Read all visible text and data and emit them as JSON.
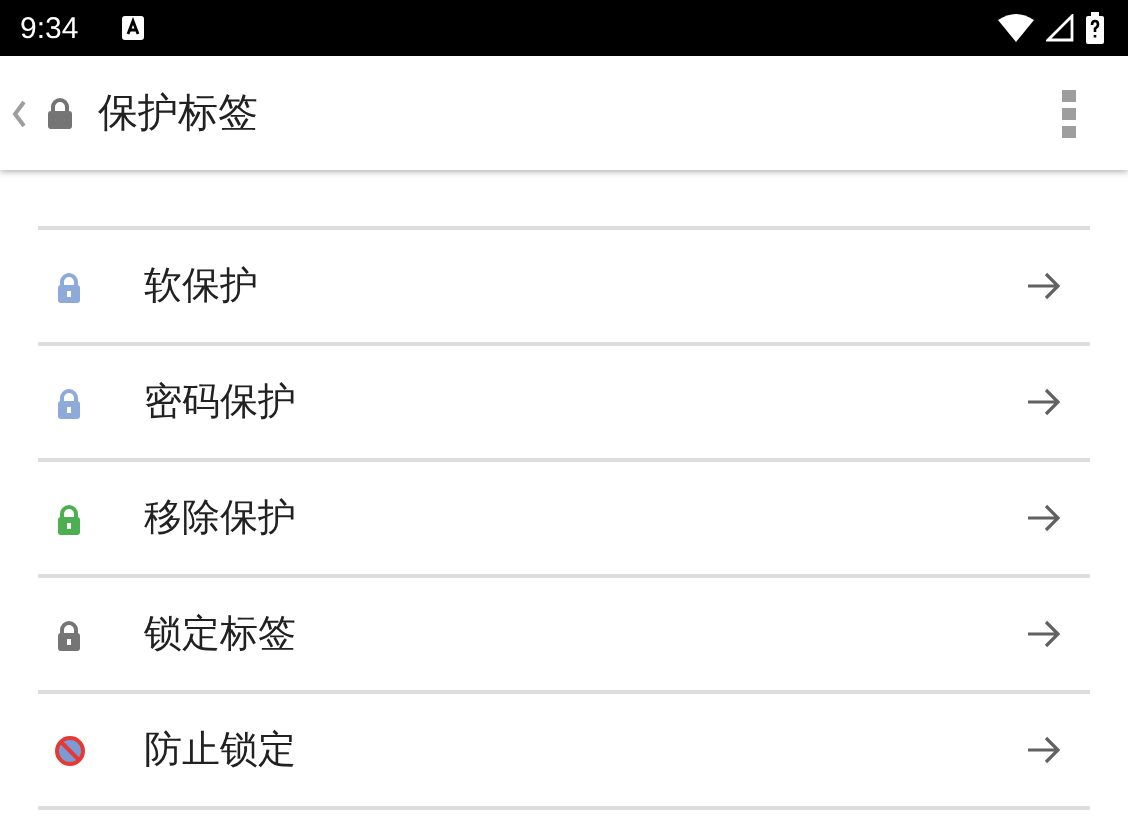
{
  "status_bar": {
    "time": "9:34"
  },
  "toolbar": {
    "title": "保护标签"
  },
  "items": [
    {
      "label": "软保护",
      "kind": "lock",
      "color": "#8eaadb"
    },
    {
      "label": "密码保护",
      "kind": "lock",
      "color": "#8eaadb"
    },
    {
      "label": "移除保护",
      "kind": "lock",
      "color": "#4caf50"
    },
    {
      "label": "锁定标签",
      "kind": "lock",
      "color": "#757575"
    },
    {
      "label": "防止锁定",
      "kind": "blocked",
      "color": "#7a9bd6"
    }
  ]
}
